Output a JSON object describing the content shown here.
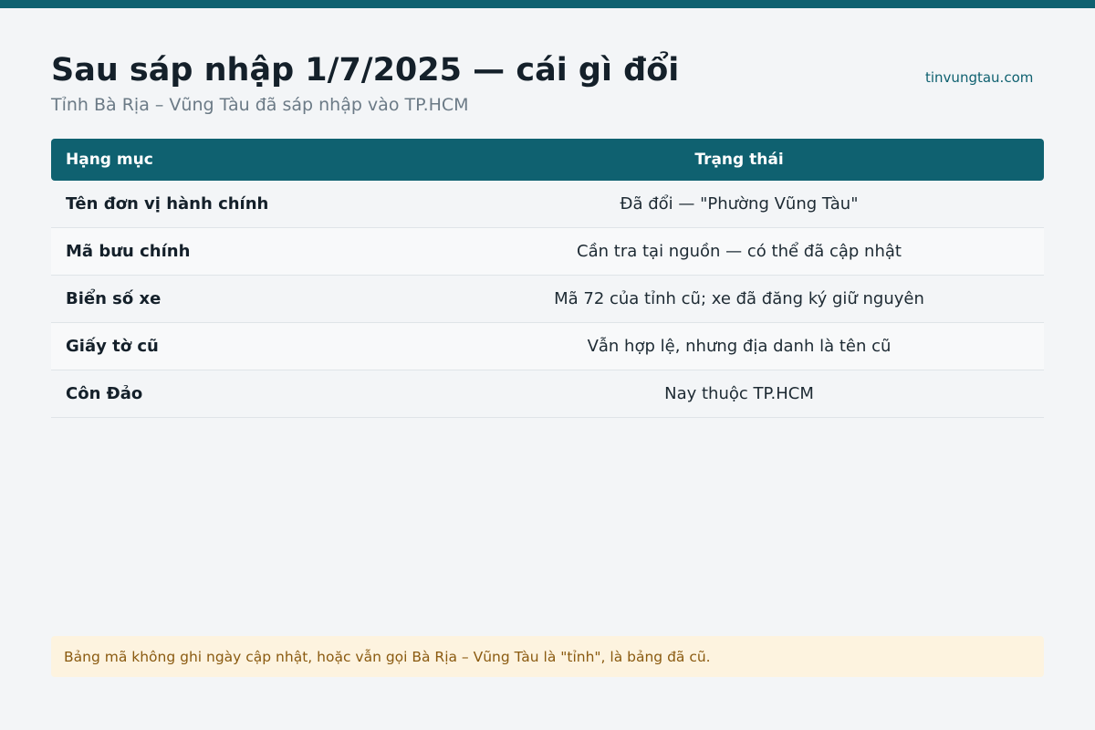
{
  "header": {
    "title": "Sau sáp nhập 1/7/2025 — cái gì đổi",
    "subtitle": "Tỉnh Bà Rịa – Vũng Tàu đã sáp nhập vào TP.HCM",
    "site": "tinvungtau.com"
  },
  "table": {
    "columns": [
      "Hạng mục",
      "Trạng thái"
    ],
    "rows": [
      {
        "item": "Tên đơn vị hành chính",
        "status": "Đã đổi — \"Phường Vũng Tàu\""
      },
      {
        "item": "Mã bưu chính",
        "status": "Cần tra tại nguồn — có thể đã cập nhật"
      },
      {
        "item": "Biển số xe",
        "status": "Mã 72 của tỉnh cũ; xe đã đăng ký giữ nguyên"
      },
      {
        "item": "Giấy tờ cũ",
        "status": "Vẫn hợp lệ, nhưng địa danh là tên cũ"
      },
      {
        "item": "Côn Đảo",
        "status": "Nay thuộc TP.HCM"
      }
    ]
  },
  "note": {
    "text": "Bảng mã không ghi ngày cập nhật, hoặc vẫn gọi Bà Rịa – Vũng Tàu là \"tỉnh\", là bảng đã cũ."
  },
  "colors": {
    "accent": "#0f6170",
    "note_background": "#fdf3df",
    "note_text": "#8a5a10"
  }
}
